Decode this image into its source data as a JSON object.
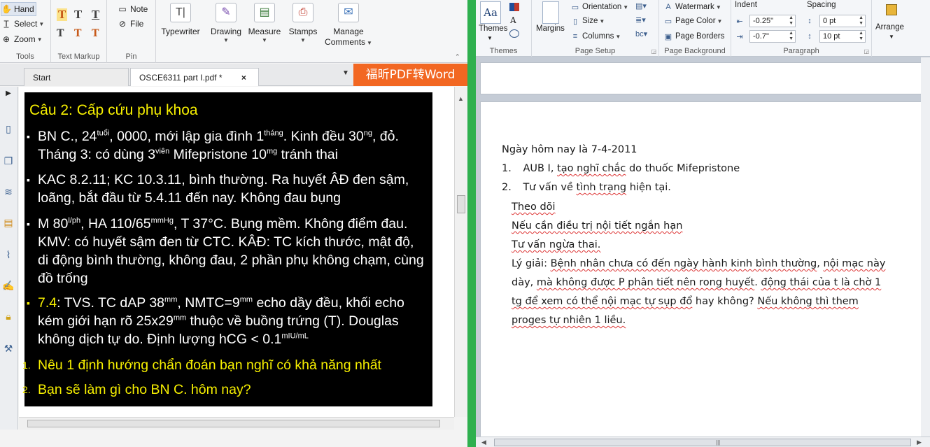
{
  "pdf_ribbon": {
    "tools": {
      "hand": "Hand",
      "select": "Select",
      "zoom": "Zoom",
      "label": "Tools"
    },
    "text_markup": {
      "label": "Text Markup"
    },
    "pin": {
      "note": "Note",
      "file": "File",
      "label": "Pin"
    },
    "typewriter": "Typewriter",
    "drawing": "Drawing",
    "measure": "Measure",
    "stamps": "Stamps",
    "manage_comments_1": "Manage",
    "manage_comments_2": "Comments"
  },
  "pdf_tabs": {
    "start": "Start",
    "document": "OSCE6311 part I.pdf *",
    "close": "×",
    "banner": "福昕PDF转Word"
  },
  "slide": {
    "title": "Câu 2: Cấp cứu phụ khoa",
    "b1": {
      "p1": "BN C., 24",
      "s1": "tuổi",
      "p2": ", 0000, mới lập gia đình 1",
      "s2": "tháng",
      "p3": ". Kinh đều 30",
      "s3": "ng",
      "p4": ", đỏ. Tháng 3: có dùng 3",
      "s4": "viên",
      "p5": " Mifepristone 10",
      "s5": "mg",
      "p6": " tránh thai"
    },
    "b2": "KAC 8.2.11; KC 10.3.11, bình thường. Ra huyết ÂĐ đen sậm, loãng, bắt đầu từ 5.4.11 đến nay. Không đau bụng",
    "b3": {
      "p1": "M 80",
      "s1": "l/ph",
      "p2": ", HA 110/65",
      "s2": "mmHg",
      "p3": ", T 37°C. Bụng mềm. Không điểm đau. KMV: có huyết sậm đen từ CTC. KÂĐ: TC kích thước, mật độ, di động bình thường, không đau, 2 phần phụ không chạm, cùng đồ trống"
    },
    "b4": {
      "date": "7.4",
      "p1": ": TVS. TC dAP 38",
      "s1": "mm",
      "p2": ", NMTC=9",
      "s2": "mm",
      "p3": " echo dầy đều, khối echo kém giới hạn rõ 25x29",
      "s3": "mm",
      "p4": " thuộc về buồng trứng (T). Douglas không dịch tự do. Định lượng hCG < 0.1",
      "s4": "mIU/mL"
    },
    "q1_num": "1.",
    "q1": "Nêu 1 định hướng chẩn đoán bạn nghĩ có khả năng nhất",
    "q2_num": "2.",
    "q2": "Bạn sẽ làm gì cho BN C. hôm nay?"
  },
  "word_ribbon": {
    "themes": "Themes",
    "themes_group": "Themes",
    "margins": "Margins",
    "orientation": "Orientation",
    "size": "Size",
    "columns": "Columns",
    "page_setup": "Page Setup",
    "watermark": "Watermark",
    "page_color": "Page Color",
    "page_borders": "Page Borders",
    "page_background": "Page Background",
    "indent": "Indent",
    "indent_left": "-0.25\"",
    "indent_right": "-0.7\"",
    "spacing": "Spacing",
    "spacing_before": "0 pt",
    "spacing_after": "10 pt",
    "paragraph": "Paragraph",
    "arrange": "Arrange"
  },
  "word_doc": {
    "l1": "Ngày hôm nay là 7-4-2011",
    "l2_num": "1.",
    "l2_a": "AUB I, ",
    "l2_b": "tạo nghĩ chắc",
    "l2_c": " do thuốc Mifepristone",
    "l3_num": "2.",
    "l3_a": "Tư vấn về ",
    "l3_b": "tình trạng",
    "l3_c": " hiện tại.",
    "l4": "Theo dõi",
    "l5": "Nếu cần điều trị nội tiết ngắn hạn",
    "l6": "Tư vấn ngừa thai.",
    "l7_a": "Lý giải: ",
    "l7_b": "Bệnh nhân chưa có đến ngày hành kinh bình thường",
    "l7_c": ", ",
    "l7_d": "nội mạc này",
    "l8_a": "dày, ",
    "l8_b": "mà không được P phân tiết nên rong huyết",
    "l8_c": ". ",
    "l8_d": "động thái của t là chờ 1",
    "l9_a": "tg để xem có thể nội mạc tự sụp đổ",
    "l9_b": " hay không? ",
    "l9_c": "Nếu không thì them",
    "l10": "proges tự nhiên 1 liều."
  }
}
